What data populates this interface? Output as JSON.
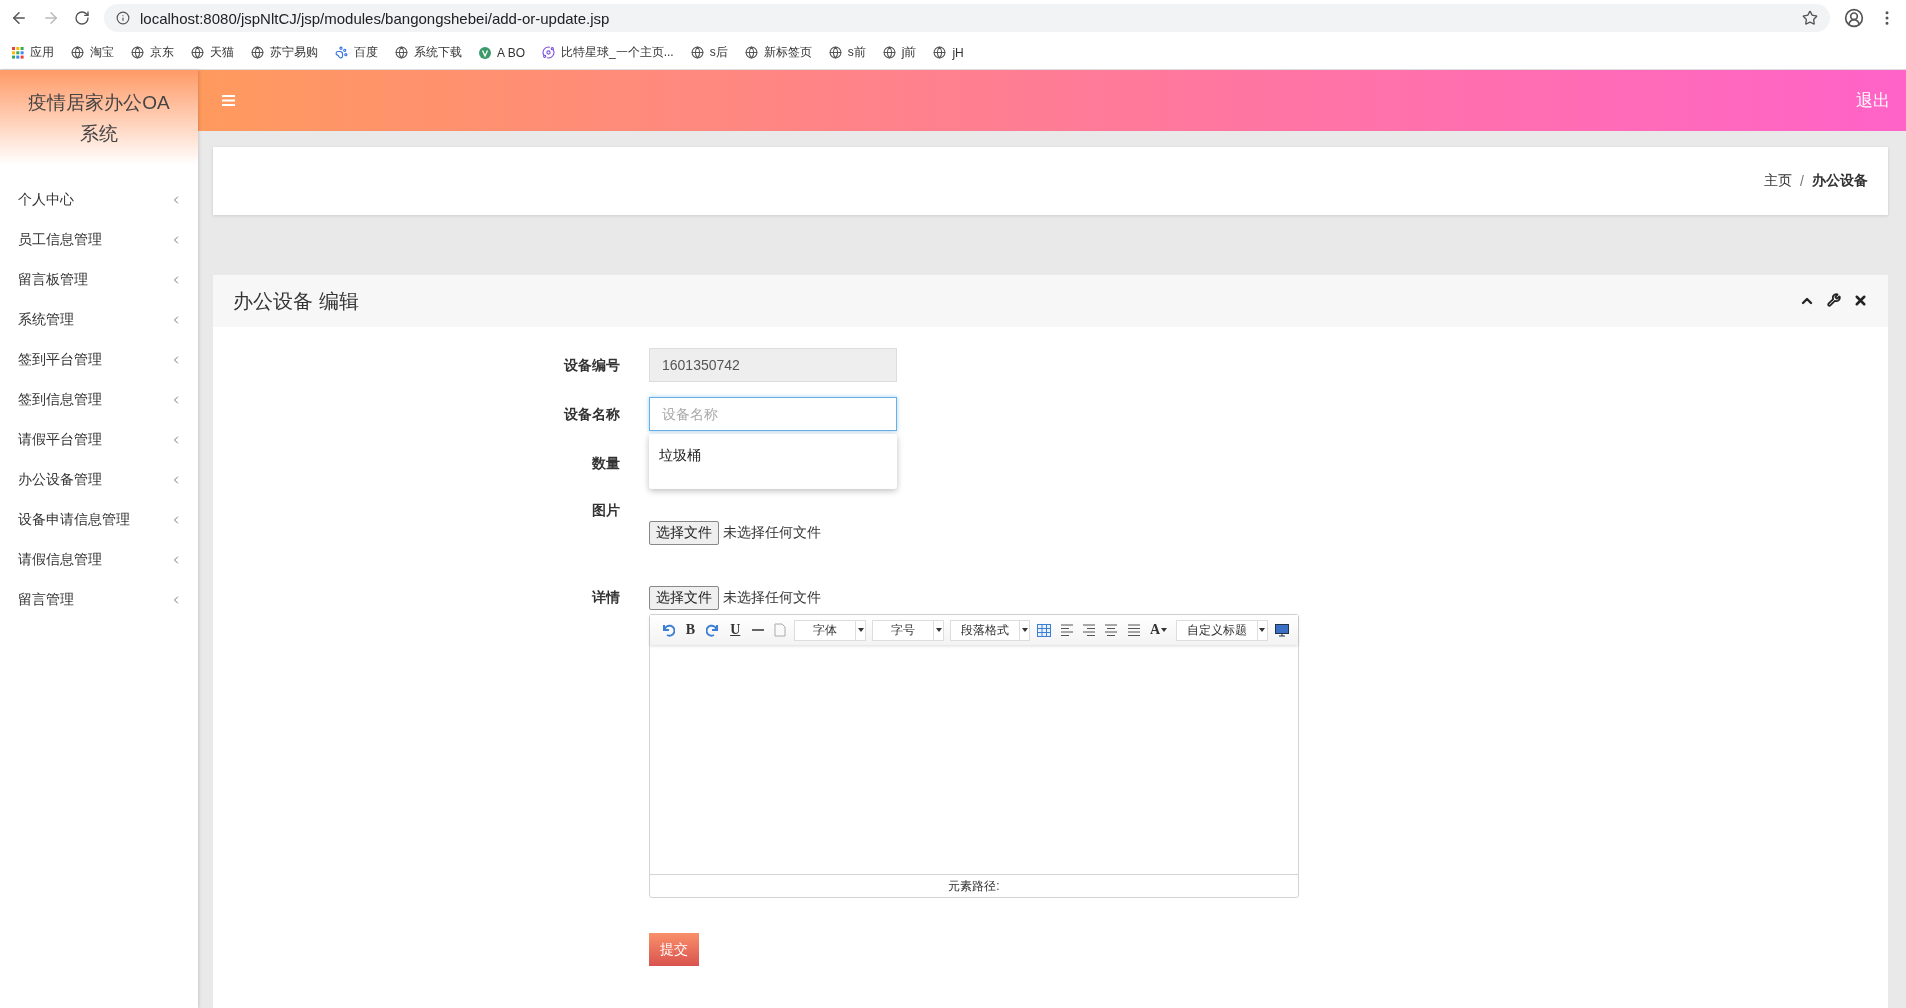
{
  "browser": {
    "url": "localhost:8080/jspNltCJ/jsp/modules/bangongshebei/add-or-update.jsp",
    "bookmarks": [
      {
        "kind": "apps",
        "label": "应用"
      },
      {
        "kind": "globe",
        "label": "淘宝"
      },
      {
        "kind": "globe",
        "label": "京东"
      },
      {
        "kind": "globe",
        "label": "天猫"
      },
      {
        "kind": "globe",
        "label": "苏宁易购"
      },
      {
        "kind": "paw",
        "label": "百度"
      },
      {
        "kind": "globe",
        "label": "系统下载"
      },
      {
        "kind": "badge",
        "label": "A BO"
      },
      {
        "kind": "planet",
        "label": "比特星球_一个主页..."
      },
      {
        "kind": "globe",
        "label": "s后"
      },
      {
        "kind": "globe",
        "label": "新标签页"
      },
      {
        "kind": "globe",
        "label": "s前"
      },
      {
        "kind": "globe",
        "label": "j前"
      },
      {
        "kind": "globe",
        "label": "jH"
      }
    ]
  },
  "app": {
    "title": "疫情居家办公OA系统",
    "logout": "退出"
  },
  "sidebar": {
    "items": [
      {
        "label": "个人中心"
      },
      {
        "label": "员工信息管理"
      },
      {
        "label": "留言板管理"
      },
      {
        "label": "系统管理"
      },
      {
        "label": "签到平台管理"
      },
      {
        "label": "签到信息管理"
      },
      {
        "label": "请假平台管理"
      },
      {
        "label": "办公设备管理"
      },
      {
        "label": "设备申请信息管理"
      },
      {
        "label": "请假信息管理"
      },
      {
        "label": "留言管理"
      }
    ]
  },
  "breadcrumb": {
    "home": "主页",
    "separator": "/",
    "current": "办公设备"
  },
  "panel": {
    "title": "办公设备 编辑"
  },
  "form": {
    "fields": [
      {
        "kind": "text",
        "label": "设备编号",
        "value": "1601350742",
        "disabled": true,
        "focused": false
      },
      {
        "kind": "text",
        "label": "设备名称",
        "placeholder": "设备名称",
        "disabled": false,
        "focused": true,
        "suggestions": [
          "垃圾桶"
        ]
      },
      {
        "kind": "covered",
        "label": "数量"
      },
      {
        "kind": "file",
        "label": "图片",
        "button": "选择文件",
        "status": "未选择任何文件"
      },
      {
        "kind": "editor",
        "label": "详情",
        "button": "选择文件",
        "status": "未选择任何文件"
      }
    ],
    "editor": {
      "toolbar": [
        {
          "kind": "undo"
        },
        {
          "kind": "glyph",
          "label": "B"
        },
        {
          "kind": "redo"
        },
        {
          "kind": "underline",
          "label": "U"
        },
        {
          "kind": "rule"
        },
        {
          "kind": "page"
        },
        {
          "kind": "select",
          "label": "字体"
        },
        {
          "kind": "select",
          "label": "字号"
        },
        {
          "kind": "select",
          "label": "段落格式"
        },
        {
          "kind": "table"
        },
        {
          "kind": "align-left"
        },
        {
          "kind": "align-right"
        },
        {
          "kind": "align-center"
        },
        {
          "kind": "justify"
        },
        {
          "kind": "color",
          "label": "A"
        },
        {
          "kind": "select",
          "label": "自定义标题"
        },
        {
          "kind": "preview"
        }
      ],
      "path": "元素路径:"
    },
    "submit": "提交"
  }
}
